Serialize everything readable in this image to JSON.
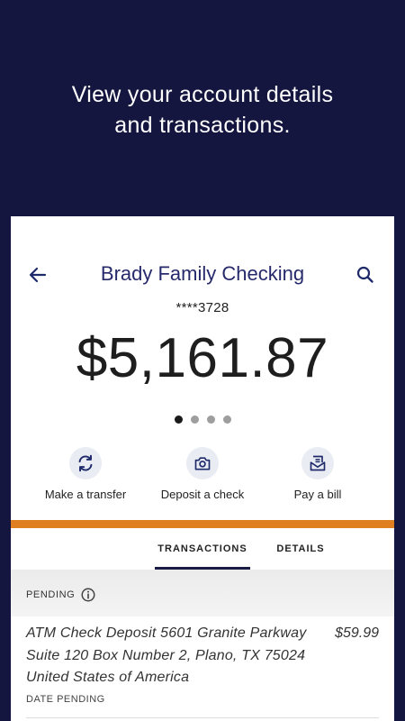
{
  "headline": {
    "line1": "View your account details",
    "line2": "and transactions."
  },
  "account": {
    "name": "Brady Family Checking",
    "masked_number": "****3728",
    "balance": "$5,161.87"
  },
  "carousel": {
    "total": 4,
    "active_index": 0
  },
  "actions": [
    {
      "label": "Make a transfer",
      "icon": "transfer-icon"
    },
    {
      "label": "Deposit a check",
      "icon": "camera-icon"
    },
    {
      "label": "Pay a bill",
      "icon": "bill-icon"
    }
  ],
  "tabs": [
    {
      "label": "TRANSACTIONS",
      "active": true
    },
    {
      "label": "DETAILS",
      "active": false
    }
  ],
  "pending": {
    "label": "PENDING",
    "transactions": [
      {
        "description": "ATM Check Deposit 5601 Granite Parkway Suite 120 Box Number 2, Plano, TX 75024 United States of America",
        "amount": "$59.99",
        "date": "DATE PENDING"
      }
    ]
  },
  "colors": {
    "background": "#14163f",
    "title": "#26296b",
    "accent_bar": "#e07f22",
    "action_circle": "#e9ecf3",
    "icon": "#1f2a6b"
  }
}
